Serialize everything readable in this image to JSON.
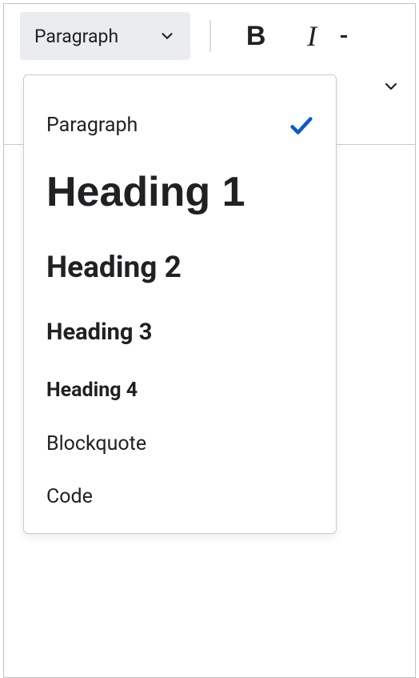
{
  "toolbar": {
    "format_selected": "Paragraph",
    "bold_label": "B",
    "italic_label": "I"
  },
  "dropdown": {
    "items": [
      {
        "label": "Paragraph",
        "selected": true
      },
      {
        "label": "Heading 1",
        "selected": false
      },
      {
        "label": "Heading 2",
        "selected": false
      },
      {
        "label": "Heading 3",
        "selected": false
      },
      {
        "label": "Heading 4",
        "selected": false
      },
      {
        "label": "Blockquote",
        "selected": false
      },
      {
        "label": "Code",
        "selected": false
      }
    ]
  }
}
